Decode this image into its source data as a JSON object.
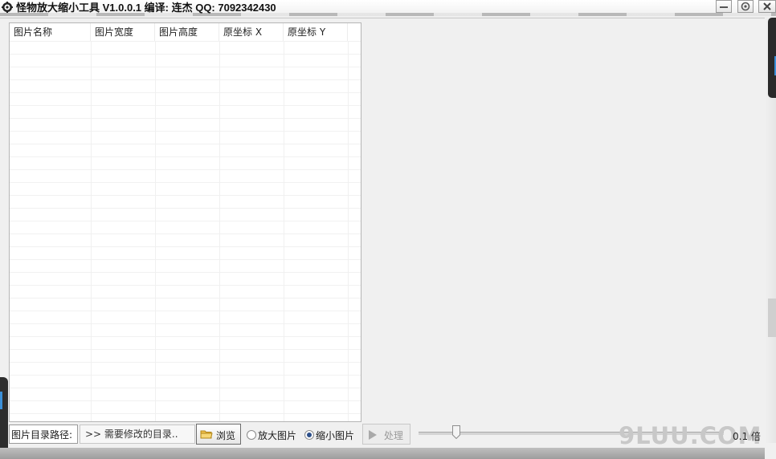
{
  "window": {
    "title": "怪物放大缩小工具 V1.0.0.1  编译: 连杰  QQ: 7092342430"
  },
  "table": {
    "columns": [
      "图片名称",
      "图片宽度",
      "图片高度",
      "原坐标 X",
      "原坐标 Y"
    ],
    "rows": []
  },
  "bottom": {
    "path_label": "图片目录路径:",
    "path_value": ">> 需要修改的目录..",
    "browse_label": "浏览",
    "enlarge_label": "放大图片",
    "shrink_label": "缩小图片",
    "selected_mode": "缩小图片",
    "process_label": "处理",
    "zoom_label": "0.1 倍",
    "watermark": "9LUU.COM"
  },
  "icons": {
    "app": "app-gear-icon",
    "minimize": "minimize-icon",
    "options": "gear-icon",
    "close": "close-icon",
    "browse": "folder-icon",
    "process": "play-icon"
  },
  "colors": {
    "accent_blue": "#3a8fd8",
    "radio_selected": "#2c4f8a"
  }
}
